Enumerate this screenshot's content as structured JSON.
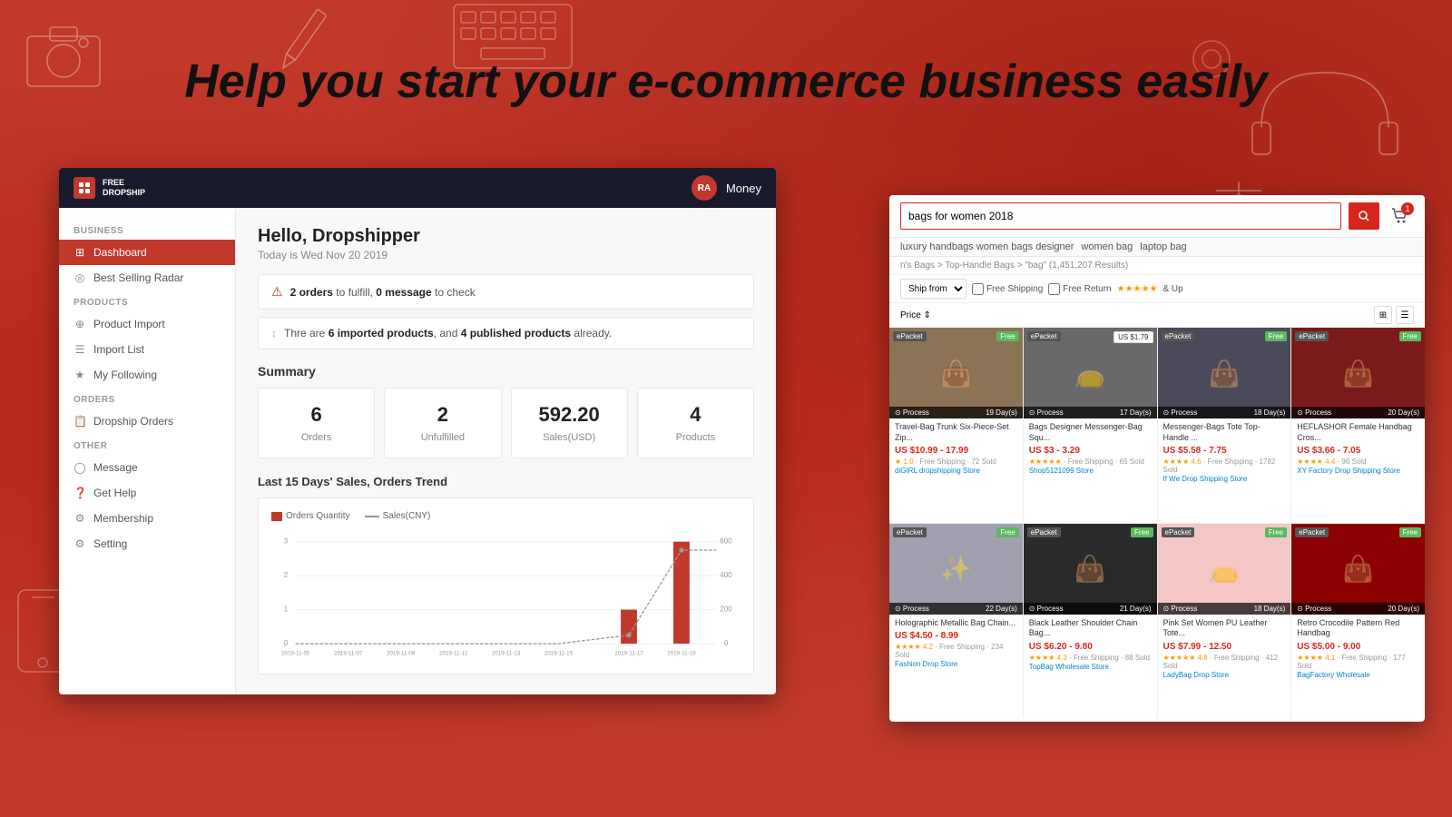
{
  "hero": {
    "text": "Help you start your e-commerce business easily"
  },
  "left_window": {
    "topbar": {
      "logo_line1": "FREE",
      "logo_line2": "DROPSHIP",
      "avatar": "RA",
      "money_label": "Money"
    },
    "sidebar": {
      "section_business": "BUSINESS",
      "section_products": "PRODUCTS",
      "section_orders": "ORDERS",
      "section_other": "OTHER",
      "items": [
        {
          "id": "dashboard",
          "label": "Dashboard",
          "active": true,
          "icon": "⊞"
        },
        {
          "id": "best-selling",
          "label": "Best Selling Radar",
          "active": false,
          "icon": "📡"
        },
        {
          "id": "product-import",
          "label": "Product Import",
          "active": false,
          "icon": "⊕"
        },
        {
          "id": "import-list",
          "label": "Import List",
          "active": false,
          "icon": "☰"
        },
        {
          "id": "my-following",
          "label": "My Following",
          "active": false,
          "icon": "★"
        },
        {
          "id": "dropship-orders",
          "label": "Dropship Orders",
          "active": false,
          "icon": "📋"
        },
        {
          "id": "message",
          "label": "Message",
          "active": false,
          "icon": "◯"
        },
        {
          "id": "get-help",
          "label": "Get Help",
          "active": false,
          "icon": "❓"
        },
        {
          "id": "membership",
          "label": "Membership",
          "active": false,
          "icon": "⚙"
        },
        {
          "id": "setting",
          "label": "Setting",
          "active": false,
          "icon": "⚙"
        }
      ]
    },
    "main": {
      "greeting": "Hello, Dropshipper",
      "date": "Today is Wed Nov 20 2019",
      "alert1": "2 orders to fulfill, 0 message to check",
      "alert1_orders": "2 orders",
      "alert1_msg": "0 message",
      "alert2": "Thre are 6 imported products, and 4 published products already.",
      "alert2_imported": "6 imported products",
      "alert2_published": "4 published products",
      "summary_title": "Summary",
      "summary": [
        {
          "value": "6",
          "label": "Orders"
        },
        {
          "value": "2",
          "label": "Unfulfilled"
        },
        {
          "value": "592.20",
          "label": "Sales(USD)"
        },
        {
          "value": "4",
          "label": "Products"
        }
      ],
      "chart_title": "Last 15 Days' Sales, Orders Trend",
      "chart_legend": [
        {
          "label": "Orders Quantity",
          "color": "#c0392b"
        },
        {
          "label": "Sales(CNY)",
          "color": "#999"
        }
      ],
      "chart_dates": [
        "2019-11-05",
        "2019-11-07",
        "2019-11-09",
        "2019-11-11",
        "2019-11-13",
        "2019-11-15",
        "2019-11-17",
        "2019-11-19"
      ],
      "chart_orders": [
        0,
        0,
        0,
        0,
        0,
        0,
        1,
        3
      ],
      "chart_sales": [
        0,
        0,
        0,
        0,
        0,
        0,
        50,
        550
      ],
      "y_left_max": 3,
      "y_right_max": 600
    }
  },
  "right_window": {
    "search_placeholder": "bags for women 2018",
    "cart_count": "1",
    "tags": [
      "luxury handbags women bags designer",
      "women bag",
      "laptop bag"
    ],
    "breadcrumb": "n's Bags > Top-Handle Bags > \"bag\" (1,451,207 Results)",
    "filter_ship_from": "Ship from",
    "filter_free_shipping": "Free Shipping",
    "filter_free_return": "Free Return",
    "filter_stars": "★★★★★ & Up",
    "view_price_sort": "Price ⇕",
    "products": [
      {
        "id": 1,
        "name": "Travel-Bag Trunk Six-Piece-Set Zip...",
        "price": "US $10.99 - 17.99",
        "shipping": "Free Shipping",
        "sold": "72 Sold",
        "rating": "★ 1.0",
        "store": "diGIRL dropshipping Store",
        "badge_left": "ePacket",
        "badge_right": "Free",
        "process_label": "Process",
        "process_days": "19 Day(s)",
        "bg": "#8B7355",
        "emoji": "👜"
      },
      {
        "id": 2,
        "name": "Bags Designer Messenger-Bag Squ...",
        "price": "US $3 - 3.29",
        "shipping": "Free Shipping",
        "sold": "65 Sold",
        "rating": "★★★★★",
        "store": "Shop5121099 Store",
        "badge_left": "ePacket",
        "badge_right": "US $1.79",
        "process_label": "Process",
        "process_days": "17 Day(s)",
        "bg": "#696969",
        "emoji": "👝"
      },
      {
        "id": 3,
        "name": "Messenger-Bags Tote Top-Handle ...",
        "price": "US $5.58 - 7.75",
        "shipping": "Free Shipping",
        "sold": "1782 Sold",
        "rating": "★★★★ 4.6",
        "store": "If We Drop Shipping Store",
        "badge_left": "ePacket",
        "badge_right": "Free",
        "process_label": "Process",
        "process_days": "18 Day(s)",
        "bg": "#4a4a5a",
        "emoji": "👜"
      },
      {
        "id": 4,
        "name": "HEFLASHOR Female Handbag Cros...",
        "price": "US $3.66 - 7.05",
        "shipping": "",
        "sold": "96 Sold",
        "rating": "★★★★ 4.4",
        "store": "XY Factory Drop Shipping Store",
        "badge_left": "ePacket",
        "badge_right": "Free",
        "process_label": "Process",
        "process_days": "20 Day(s)",
        "bg": "#8B1A1A",
        "emoji": "👜"
      },
      {
        "id": 5,
        "name": "Holographic Metallic Bag Chain...",
        "price": "US $4.50 - 8.99",
        "shipping": "Free Shipping",
        "sold": "234 Sold",
        "rating": "★★★★ 4.2",
        "store": "Fashion Drop Store",
        "badge_left": "ePacket",
        "badge_right": "Free",
        "process_label": "Process",
        "process_days": "22 Day(s)",
        "bg": "#silver",
        "emoji": "✨"
      },
      {
        "id": 6,
        "name": "Black Leather Shoulder Chain Bag...",
        "price": "US $6.20 - 9.80",
        "shipping": "Free Shipping",
        "sold": "88 Sold",
        "rating": "★★★★ 4.3",
        "store": "TopBag Wholesale Store",
        "badge_left": "ePacket",
        "badge_right": "Free",
        "process_label": "Process",
        "process_days": "21 Day(s)",
        "bg": "#2a2a2a",
        "emoji": "👜"
      },
      {
        "id": 7,
        "name": "Pink Set Women PU Leather Tote...",
        "price": "US $7.99 - 12.50",
        "shipping": "Free Shipping",
        "sold": "412 Sold",
        "rating": "★★★★★ 4.8",
        "store": "LadyBag Drop Store",
        "badge_left": "ePacket",
        "badge_right": "Free",
        "process_label": "Process",
        "process_days": "18 Day(s)",
        "bg": "#f5c6c6",
        "emoji": "👝"
      },
      {
        "id": 8,
        "name": "Retro Crocodile Pattern Red Handbag",
        "price": "US $5.00 - 9.00",
        "shipping": "Free Shipping",
        "sold": "177 Sold",
        "rating": "★★★★ 4.1",
        "store": "BagFactory Wholesale",
        "badge_left": "ePacket",
        "badge_right": "Free",
        "process_label": "Process",
        "process_days": "20 Day(s)",
        "bg": "#8B0000",
        "emoji": "👜"
      }
    ]
  }
}
